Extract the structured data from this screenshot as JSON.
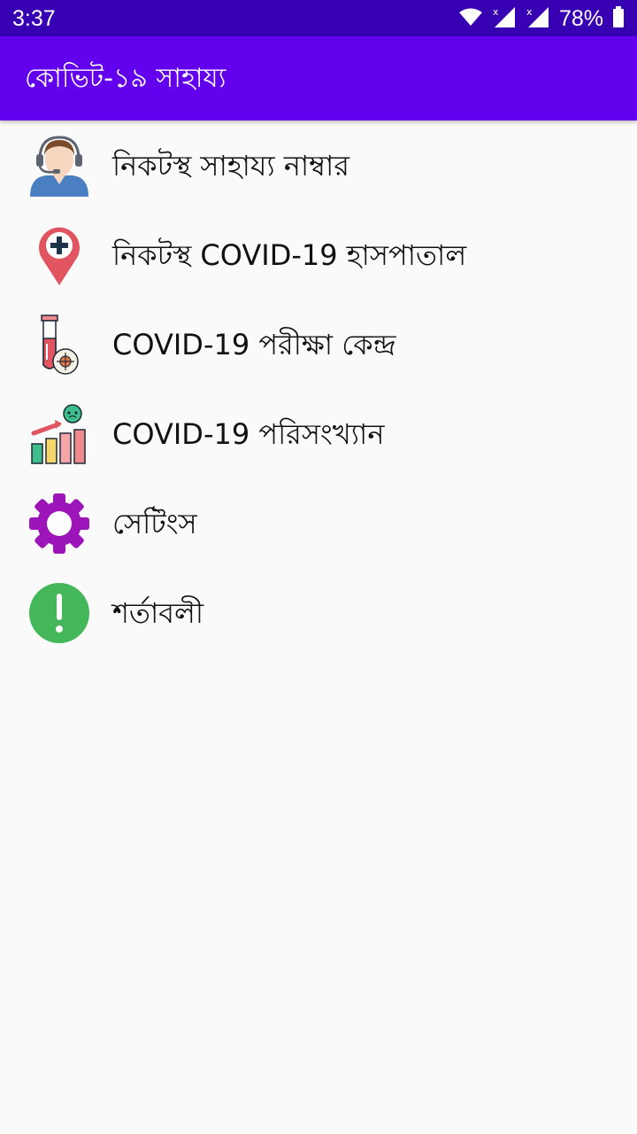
{
  "status_bar": {
    "time": "3:37",
    "battery": "78%",
    "icons": [
      "wifi-icon",
      "signal-icon",
      "signal-icon",
      "battery-icon"
    ]
  },
  "app_bar": {
    "title": "কোভিট-১৯ সাহায্য"
  },
  "menu": {
    "items": [
      {
        "label": "নিকটস্থ সাহায্য নাম্বার",
        "icon": "support-agent-icon"
      },
      {
        "label": "নিকটস্থ COVID-19 হাসপাতাল",
        "icon": "hospital-location-icon"
      },
      {
        "label": "COVID-19 পরীক্ষা কেন্দ্র",
        "icon": "test-tube-icon"
      },
      {
        "label": "COVID-19 পরিসংখ্যান",
        "icon": "statistics-icon"
      },
      {
        "label": "সেটিংস",
        "icon": "gear-icon"
      },
      {
        "label": "শর্তাবলী",
        "icon": "info-alert-icon"
      }
    ]
  },
  "colors": {
    "status_bar": "#3700B3",
    "app_bar": "#6200EE",
    "background": "#FAFAFA",
    "gear": "#9C15B8",
    "alert": "#43B75A",
    "pin": "#E05560"
  }
}
